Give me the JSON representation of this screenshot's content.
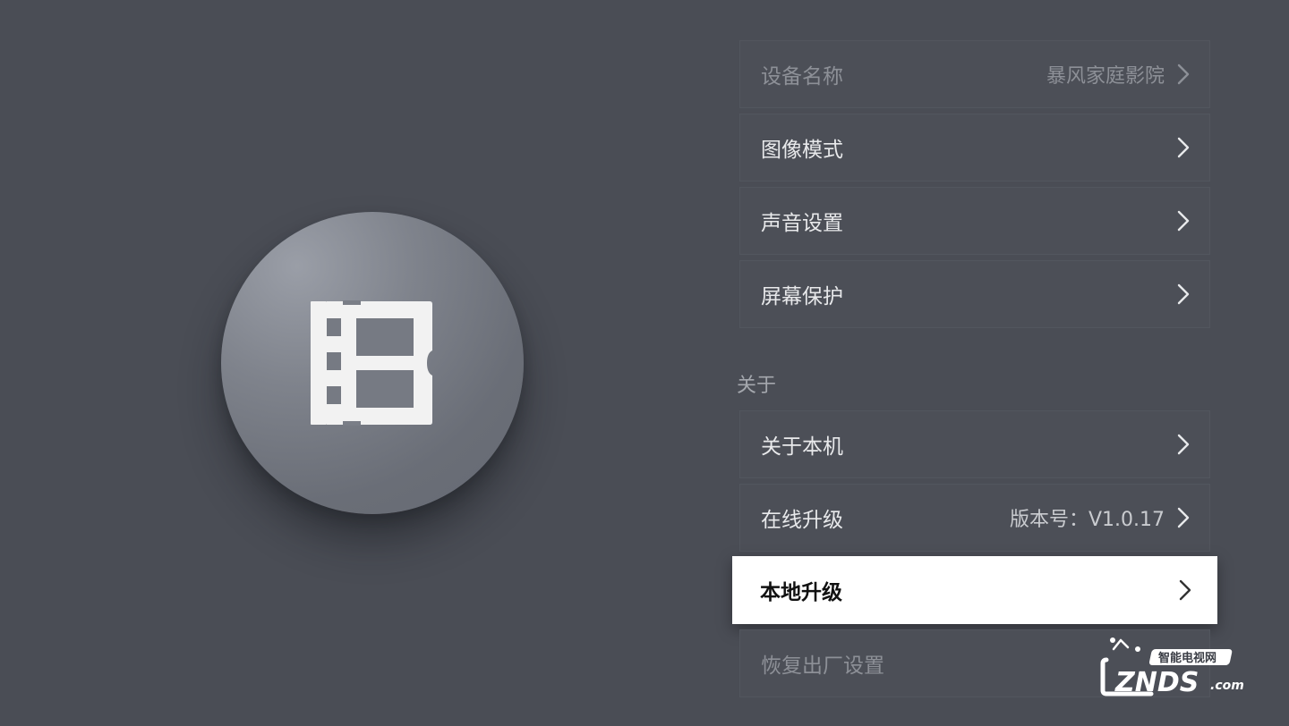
{
  "menu": {
    "items": [
      {
        "label": "设备名称",
        "value": "暴风家庭影院",
        "state": "faded"
      },
      {
        "label": "图像模式",
        "value": "",
        "state": "normal"
      },
      {
        "label": "声音设置",
        "value": "",
        "state": "normal"
      },
      {
        "label": "屏幕保护",
        "value": "",
        "state": "normal"
      },
      {
        "label": "关于本机",
        "value": "",
        "state": "normal"
      },
      {
        "label": "在线升级",
        "value": "版本号：V1.0.17",
        "state": "normal"
      },
      {
        "label": "本地升级",
        "value": "",
        "state": "focused"
      },
      {
        "label": "恢复出厂设置",
        "value": "",
        "state": "faded"
      }
    ],
    "section_about": "关于"
  },
  "watermark": {
    "top_text": "智能电视网",
    "brand": "ZNDS",
    "suffix": ".com"
  },
  "colors": {
    "background": "#4a4d55",
    "focus_bg": "#ffffff",
    "text_primary": "#e8e9eb"
  },
  "icons": {
    "logo": "film-strip-icon",
    "chevron": "chevron-right-icon"
  }
}
